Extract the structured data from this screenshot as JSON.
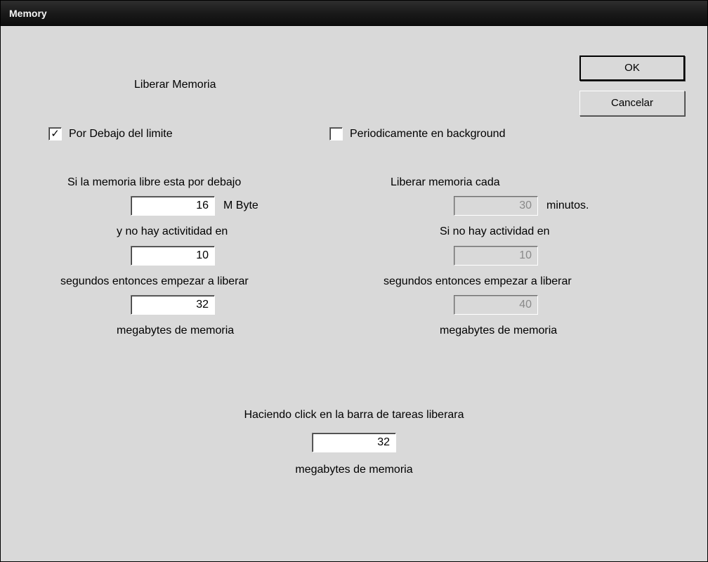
{
  "window": {
    "title": "Memory"
  },
  "heading": "Liberar Memoria",
  "buttons": {
    "ok": "OK",
    "cancel": "Cancelar"
  },
  "left": {
    "checkbox_label": "Por Debajo del limite",
    "checked_glyph": "✓",
    "l1": "Si la memoria libre esta por debajo",
    "v1": "16",
    "u1": "M Byte",
    "l2": "y no hay activitidad en",
    "v2": "10",
    "l3": "segundos entonces empezar a liberar",
    "v3": "32",
    "l4": "megabytes de memoria"
  },
  "right": {
    "checkbox_label": "Periodicamente en background",
    "l1": "Liberar memoria cada",
    "v1": "30",
    "u1": "minutos.",
    "l2": "Si no hay actividad en",
    "v2": "10",
    "l3": "segundos entonces empezar a liberar",
    "v3": "40",
    "l4": "megabytes de memoria"
  },
  "footer": {
    "l1": "Haciendo click en la barra de tareas liberara",
    "v1": "32",
    "l2": "megabytes de memoria"
  }
}
